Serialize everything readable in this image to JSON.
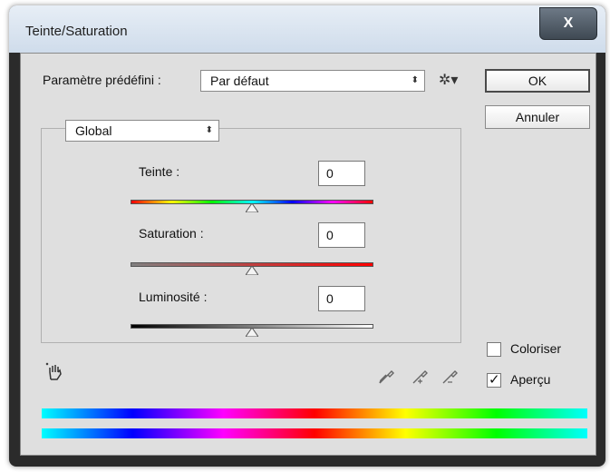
{
  "window": {
    "title": "Teinte/Saturation",
    "close_label": "X"
  },
  "preset": {
    "label": "Paramètre prédéfini :",
    "value": "Par défaut",
    "gear_icon": "gear-dropdown-icon"
  },
  "buttons": {
    "ok": "OK",
    "cancel": "Annuler"
  },
  "channel": {
    "value": "Global"
  },
  "sliders": [
    {
      "label": "Teinte :",
      "value": "0",
      "position": 0.5
    },
    {
      "label": "Saturation :",
      "value": "0",
      "position": 0.5
    },
    {
      "label": "Luminosité :",
      "value": "0",
      "position": 0.5
    }
  ],
  "options": {
    "colorize_label": "Coloriser",
    "colorize_checked": false,
    "preview_label": "Aperçu",
    "preview_checked": true
  },
  "icons": {
    "hand": "hand-adjust-icon",
    "eyedropper": "eyedropper-icon",
    "eyedropper_add": "eyedropper-add-icon",
    "eyedropper_subtract": "eyedropper-subtract-icon"
  }
}
